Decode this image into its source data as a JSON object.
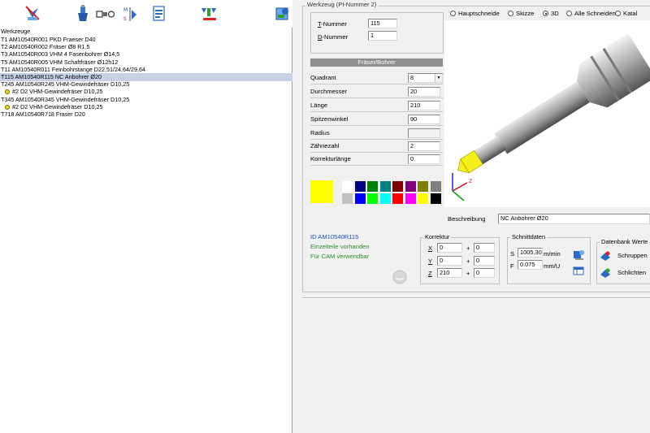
{
  "toolbar": {
    "icons": [
      "tool-manage-icon",
      "drill-holder-icon",
      "tool-assembly-icon",
      "measure-icon",
      "document-icon",
      "sort-tree-icon",
      "catalog-icon"
    ]
  },
  "tree": {
    "header": "Werkzeuge",
    "rows": [
      {
        "text": "T1 AM10540R001 PKD Fraeser D40",
        "level": 0,
        "selected": false
      },
      {
        "text": "T2 AM10540R002 Fräser Ø8 R1.5",
        "level": 0,
        "selected": false
      },
      {
        "text": "T3 AM10540R003 VHM 4 Fasenbohrer Ø14,5",
        "level": 0,
        "selected": false
      },
      {
        "text": "T5 AM10540R005 VHM Schaftfräser Ø12h12",
        "level": 0,
        "selected": false
      },
      {
        "text": "T11 AM10540R011 Feinbohrstange D22,51/24,64/29,64",
        "level": 0,
        "selected": false
      },
      {
        "text": "T115 AM10540R115 NC Anbohrer Ø20",
        "level": 0,
        "selected": true
      },
      {
        "text": "T245 AM10540R245 VHM-Gewindefräser  D10,25",
        "level": 0,
        "selected": false
      },
      {
        "text": "#2 D2 VHM-Gewindefräser  D10,25",
        "level": 1,
        "selected": false
      },
      {
        "text": "T345 AM10540R345 VHM-Gewindefräser  D10,25",
        "level": 0,
        "selected": false
      },
      {
        "text": "#2 D2 VHM-Gewindefräser  D10,25",
        "level": 1,
        "selected": false
      },
      {
        "text": "T718 AM10540R718 Fraser D20",
        "level": 0,
        "selected": false
      }
    ]
  },
  "werkzeug": {
    "group_title": "Werkzeug (PI-Nummer 2)",
    "t_label_prefix": "T",
    "t_label_rest": "-Nummer",
    "t_value": "115",
    "d_label_prefix": "D",
    "d_label_rest": "-Nummer",
    "d_value": "1"
  },
  "fraser": {
    "header": "Fräser/Bohrer",
    "fields": [
      {
        "label": "Quadrant",
        "value": "8",
        "type": "combo",
        "enabled": true
      },
      {
        "label": "Durchmesser",
        "value": "20",
        "enabled": true
      },
      {
        "label": "Länge",
        "value": "210",
        "enabled": true
      },
      {
        "label": "Spitzenwinkel",
        "value": "90",
        "enabled": true
      },
      {
        "label": "Radius",
        "value": "",
        "enabled": false
      },
      {
        "label": "Zähnezahl",
        "value": "2",
        "enabled": true
      },
      {
        "label": "Korrekturlänge",
        "value": "0",
        "enabled": true
      }
    ]
  },
  "colors": {
    "selected": "#ffff00",
    "row1": [
      "#ffffff",
      "#000080",
      "#008000",
      "#008080",
      "#800000",
      "#800080",
      "#808000",
      "#808080"
    ],
    "row2": [
      "#c0c0c0",
      "#0000ff",
      "#00ff00",
      "#00ffff",
      "#ff0000",
      "#ff00ff",
      "#ffff00",
      "#000000"
    ]
  },
  "view_options": {
    "options": [
      "Hauptschneide",
      "Skizze",
      "3D",
      "Alle Schneiden",
      "Katal"
    ],
    "selected": "3D"
  },
  "beschreibung": {
    "label": "Beschreibung",
    "value": "NC Anbohrer Ø20"
  },
  "status": {
    "id_text": "ID AM10540R115",
    "line1": "Einzelteile vorhanden",
    "line2": "Für CAM verwendbar"
  },
  "korrektur": {
    "title": "Korrektur",
    "rows": [
      {
        "axis": "X",
        "value": "0",
        "offset": "0"
      },
      {
        "axis": "Y",
        "value": "0",
        "offset": "0"
      },
      {
        "axis": "Z",
        "value": "210",
        "offset": "0"
      }
    ],
    "plus": "+"
  },
  "schnittdaten": {
    "title": "Schnittdaten",
    "s_label": "S",
    "s_value": "1005.30",
    "s_unit": "m/min",
    "f_label": "F",
    "f_value": "0.075",
    "f_unit": "mm/U"
  },
  "datenbank": {
    "title": "Datenbank Werte",
    "schruppen": "Schruppen",
    "schlichten": "Schlichten"
  }
}
